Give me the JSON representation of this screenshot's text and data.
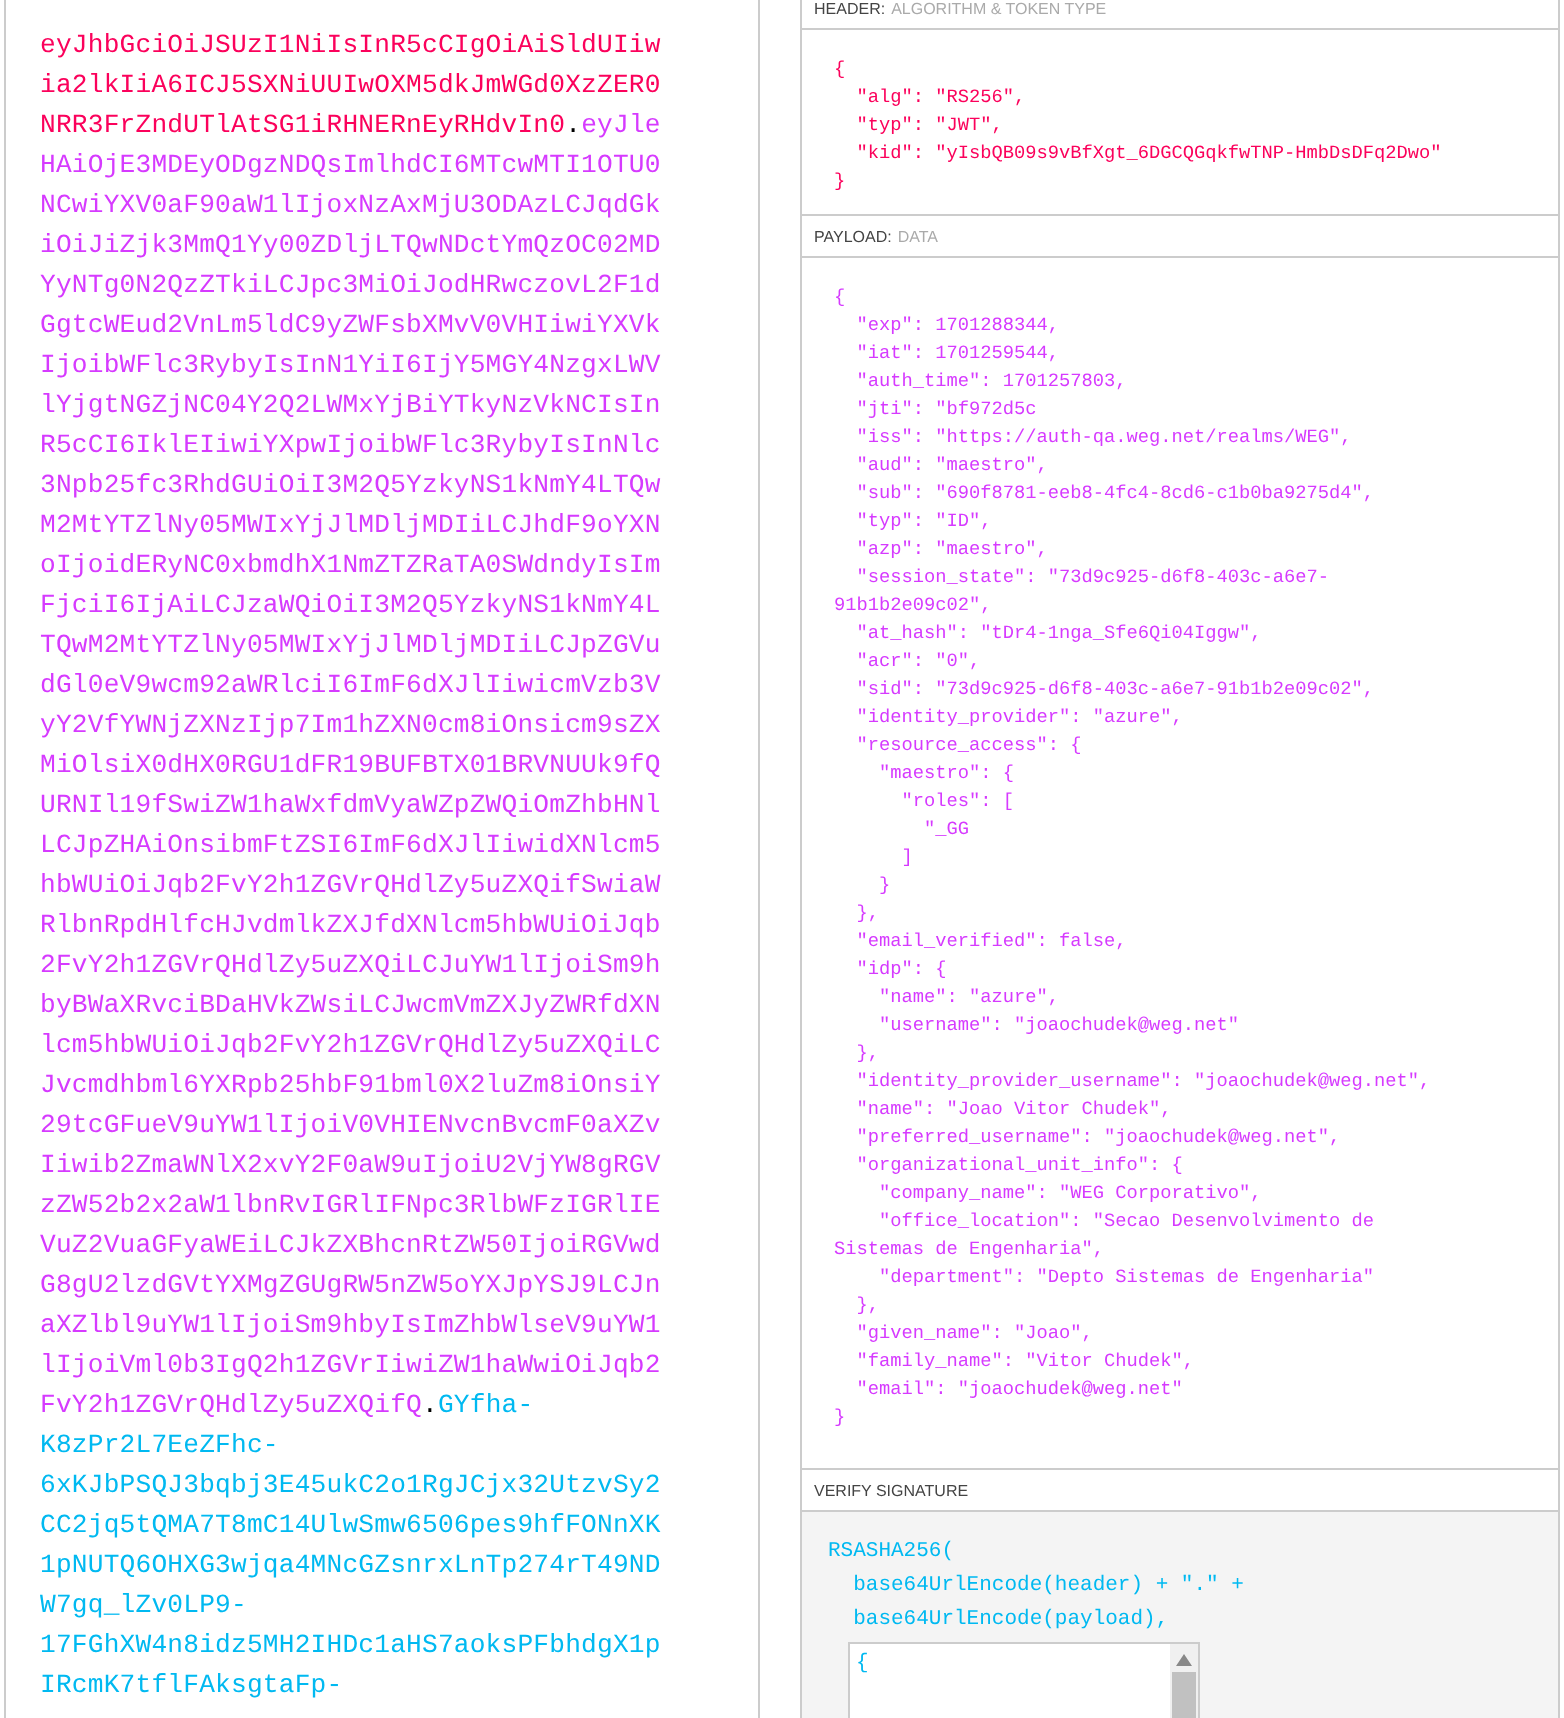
{
  "encoded": {
    "lines": [
      [
        {
          "kind": "header",
          "text": "eyJhbGciOiJSUzI1NiIsInR5cCIgOiAiSldUIiw"
        }
      ],
      [
        {
          "kind": "header",
          "text": "ia2lkIiA6ICJ5SXNiUUIwOXM5dkJmWGd0XzZER0"
        }
      ],
      [
        {
          "kind": "header",
          "text": "NRR3FrZndUTlAtSG1iRHNERnEyRHdvIn0"
        },
        {
          "kind": "dot",
          "text": "."
        },
        {
          "kind": "payload",
          "text": "eyJle"
        }
      ],
      [
        {
          "kind": "payload",
          "text": "HAiOjE3MDEyODgzNDQsImlhdCI6MTcwMTI1OTU0"
        }
      ],
      [
        {
          "kind": "payload",
          "text": "NCwiYXV0aF90aW1lIjoxNzAxMjU3ODAzLCJqdGk"
        }
      ],
      [
        {
          "kind": "payload",
          "text": "iOiJiZjk3MmQ1Yy00ZDljLTQwNDctYmQzOC02MD"
        }
      ],
      [
        {
          "kind": "payload",
          "text": "YyNTg0N2QzZTkiLCJpc3MiOiJodHRwczovL2F1d"
        }
      ],
      [
        {
          "kind": "payload",
          "text": "GgtcWEud2VnLm5ldC9yZWFsbXMvV0VHIiwiYXVk"
        }
      ],
      [
        {
          "kind": "payload",
          "text": "IjoibWFlc3RybyIsInN1YiI6IjY5MGY4NzgxLWV"
        }
      ],
      [
        {
          "kind": "payload",
          "text": "lYjgtNGZjNC04Y2Q2LWMxYjBiYTkyNzVkNCIsIn"
        }
      ],
      [
        {
          "kind": "payload",
          "text": "R5cCI6IklEIiwiYXpwIjoibWFlc3RybyIsInNlc"
        }
      ],
      [
        {
          "kind": "payload",
          "text": "3Npb25fc3RhdGUiOiI3M2Q5YzkyNS1kNmY4LTQw"
        }
      ],
      [
        {
          "kind": "payload",
          "text": "M2MtYTZlNy05MWIxYjJlMDljMDIiLCJhdF9oYXN"
        }
      ],
      [
        {
          "kind": "payload",
          "text": "oIjoidERyNC0xbmdhX1NmZTZRaTA0SWdndyIsIm"
        }
      ],
      [
        {
          "kind": "payload",
          "text": "FjciI6IjAiLCJzaWQiOiI3M2Q5YzkyNS1kNmY4L"
        }
      ],
      [
        {
          "kind": "payload",
          "text": "TQwM2MtYTZlNy05MWIxYjJlMDljMDIiLCJpZGVu"
        }
      ],
      [
        {
          "kind": "payload",
          "text": "dGl0eV9wcm92aWRlciI6ImF6dXJlIiwicmVzb3V"
        }
      ],
      [
        {
          "kind": "payload",
          "text": "yY2VfYWNjZXNzIjp7Im1hZXN0cm8iOnsicm9sZX"
        }
      ],
      [
        {
          "kind": "payload",
          "text": "MiOlsiX0dHX0RGU1dFR19BUFBTX01BRVNUUk9fQ"
        }
      ],
      [
        {
          "kind": "payload",
          "text": "URNIl19fSwiZW1haWxfdmVyaWZpZWQiOmZhbHNl"
        }
      ],
      [
        {
          "kind": "payload",
          "text": "LCJpZHAiOnsibmFtZSI6ImF6dXJlIiwidXNlcm5"
        }
      ],
      [
        {
          "kind": "payload",
          "text": "hbWUiOiJqb2FvY2h1ZGVrQHdlZy5uZXQifSwiaW"
        }
      ],
      [
        {
          "kind": "payload",
          "text": "RlbnRpdHlfcHJvdmlkZXJfdXNlcm5hbWUiOiJqb"
        }
      ],
      [
        {
          "kind": "payload",
          "text": "2FvY2h1ZGVrQHdlZy5uZXQiLCJuYW1lIjoiSm9h"
        }
      ],
      [
        {
          "kind": "payload",
          "text": "byBWaXRvciBDaHVkZWsiLCJwcmVmZXJyZWRfdXN"
        }
      ],
      [
        {
          "kind": "payload",
          "text": "lcm5hbWUiOiJqb2FvY2h1ZGVrQHdlZy5uZXQiLC"
        }
      ],
      [
        {
          "kind": "payload",
          "text": "Jvcmdhbml6YXRpb25hbF91bml0X2luZm8iOnsiY"
        }
      ],
      [
        {
          "kind": "payload",
          "text": "29tcGFueV9uYW1lIjoiV0VHIENvcnBvcmF0aXZv"
        }
      ],
      [
        {
          "kind": "payload",
          "text": "Iiwib2ZmaWNlX2xvY2F0aW9uIjoiU2VjYW8gRGV"
        }
      ],
      [
        {
          "kind": "payload",
          "text": "zZW52b2x2aW1lbnRvIGRlIFNpc3RlbWFzIGRlIE"
        }
      ],
      [
        {
          "kind": "payload",
          "text": "VuZ2VuaGFyaWEiLCJkZXBhcnRtZW50IjoiRGVwd"
        }
      ],
      [
        {
          "kind": "payload",
          "text": "G8gU2lzdGVtYXMgZGUgRW5nZW5oYXJpYSJ9LCJn"
        }
      ],
      [
        {
          "kind": "payload",
          "text": "aXZlbl9uYW1lIjoiSm9hbyIsImZhbWlseV9uYW1"
        }
      ],
      [
        {
          "kind": "payload",
          "text": "lIjoiVml0b3IgQ2h1ZGVrIiwiZW1haWwiOiJqb2"
        }
      ],
      [
        {
          "kind": "payload",
          "text": "FvY2h1ZGVrQHdlZy5uZXQifQ"
        },
        {
          "kind": "dot",
          "text": "."
        },
        {
          "kind": "signature",
          "text": "GYfha-"
        }
      ],
      [
        {
          "kind": "signature",
          "text": "K8zPr2L7EeZFhc-"
        }
      ],
      [
        {
          "kind": "signature",
          "text": "6xKJbPSQJ3bqbj3E45ukC2o1RgJCjx32UtzvSy2"
        }
      ],
      [
        {
          "kind": "signature",
          "text": "CC2jq5tQMA7T8mC14UlwSmw6506pes9hfFONnXK"
        }
      ],
      [
        {
          "kind": "signature",
          "text": "1pNUTQ6OHXG3wjqa4MNcGZsnrxLnTp274rT49ND"
        }
      ],
      [
        {
          "kind": "signature",
          "text": "W7gq_lZv0LP9-"
        }
      ],
      [
        {
          "kind": "signature",
          "text": "17FGhXW4n8idz5MH2IHDc1aHS7aoksPFbhdgX1p"
        }
      ],
      [
        {
          "kind": "signature",
          "text": "IRcmK7tflFAksgtaFp-"
        }
      ]
    ]
  },
  "sections": [
    {
      "kind": "header",
      "title": "HEADER:",
      "subtitle": "ALGORITHM & TOKEN TYPE",
      "lines": [
        "{",
        "  \"alg\": \"RS256\",",
        "  \"typ\": \"JWT\",",
        "  \"kid\": \"yIsbQB09s9vBfXgt_6DGCQGqkfwTNP-HmbDsDFq2Dwo\"",
        "}"
      ]
    },
    {
      "kind": "payload",
      "title": "PAYLOAD:",
      "subtitle": "DATA",
      "lines": [
        "{",
        "  \"exp\": 1701288344,",
        "  \"iat\": 1701259544,",
        "  \"auth_time\": 1701257803,",
        "  \"jti\": \"bf972d5c",
        "  \"iss\": \"https://auth-qa.weg.net/realms/WEG\",",
        "  \"aud\": \"maestro\",",
        "  \"sub\": \"690f8781-eeb8-4fc4-8cd6-c1b0ba9275d4\",",
        "  \"typ\": \"ID\",",
        "  \"azp\": \"maestro\",",
        "  \"session_state\": \"73d9c925-d6f8-403c-a6e7-",
        "91b1b2e09c02\",",
        "  \"at_hash\": \"tDr4-1nga_Sfe6Qi04Iggw\",",
        "  \"acr\": \"0\",",
        "  \"sid\": \"73d9c925-d6f8-403c-a6e7-91b1b2e09c02\",",
        "  \"identity_provider\": \"azure\",",
        "  \"resource_access\": {",
        "    \"maestro\": {",
        "      \"roles\": [",
        "        \"_GG",
        "      ]",
        "    }",
        "  },",
        "  \"email_verified\": false,",
        "  \"idp\": {",
        "    \"name\": \"azure\",",
        "    \"username\": \"joaochudek@weg.net\"",
        "  },",
        "  \"identity_provider_username\": \"joaochudek@weg.net\",",
        "  \"name\": \"Joao Vitor Chudek\",",
        "  \"preferred_username\": \"joaochudek@weg.net\",",
        "  \"organizational_unit_info\": {",
        "    \"company_name\": \"WEG Corporativo\",",
        "    \"office_location\": \"Secao Desenvolvimento de",
        "Sistemas de Engenharia\",",
        "    \"department\": \"Depto Sistemas de Engenharia\"",
        "  },",
        "  \"given_name\": \"Joao\",",
        "  \"family_name\": \"Vitor Chudek\",",
        "  \"email\": \"joaochudek@weg.net\"",
        "}"
      ]
    },
    {
      "kind": "verify",
      "title": "VERIFY SIGNATURE",
      "lines": [
        "RSASHA256(",
        "  base64UrlEncode(header) + \".\" +",
        "  base64UrlEncode(payload),"
      ],
      "key_field": {
        "value": "{"
      }
    }
  ]
}
